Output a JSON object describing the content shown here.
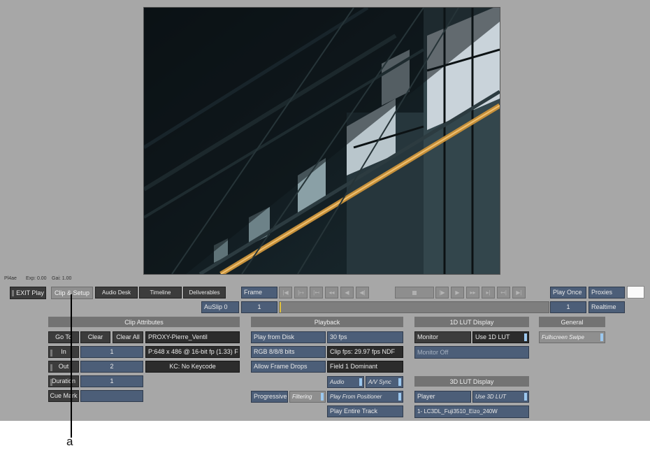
{
  "info": {
    "view": "Pl4ae",
    "exp": "Exp: 0.00",
    "gain": "Gai: 1.00"
  },
  "nav": {
    "exit": "EXIT Play",
    "clip_setup": "Clip & Setup",
    "audio_desk": "Audio Desk",
    "timeline": "Timeline",
    "deliverables": "Deliverables"
  },
  "transport": {
    "mode": "Frame",
    "buttons": [
      "|◀",
      "|↦",
      "|↤",
      "◂◂",
      "◀",
      "◀|",
      "|▶",
      "▶",
      "▸▸",
      "▸|",
      "↤|",
      "▶|"
    ],
    "play_once": "Play Once",
    "proxies": "Proxies",
    "auslip": "AuSlip 0",
    "frame_field": "1",
    "frame_end": "1",
    "realtime": "Realtime"
  },
  "clip": {
    "header": "Clip Attributes",
    "goto": "Go To",
    "clear": "Clear",
    "clear_all": "Clear All",
    "in": "In",
    "in_val": "1",
    "out": "Out",
    "out_val": "2",
    "duration": "Duration",
    "duration_val": "1",
    "cue_mark": "Cue Mark",
    "cue_val": "",
    "name": "PROXY-Pierre_Ventil",
    "format": "P:648 x 486 @ 16-bit fp (1.33) F",
    "keycode": "KC: No Keycode"
  },
  "playback": {
    "header": "Playback",
    "play_from": "Play from Disk",
    "fps": "30 fps",
    "rgb": "RGB 8/8/8 bits",
    "clip_fps": "Clip fps: 29.97 fps NDF",
    "frame_drops": "Allow Frame Drops",
    "field": "Field 1 Dominant",
    "audio": "Audio",
    "av_sync": "A/V Sync",
    "progressive": "Progressive",
    "filtering": "Filtering",
    "play_positioner": "Play From Positioner",
    "play_track": "Play Entire Track"
  },
  "lut1d": {
    "header": "1D LUT Display",
    "monitor": "Monitor",
    "use": "Use 1D LUT",
    "monitor_off": "Monitor Off"
  },
  "lut3d": {
    "header": "3D LUT Display",
    "player": "Player",
    "use": "Use 3D LUT",
    "lut_name": "1- LC3DL_Fuji3510_Eizo_240W"
  },
  "general": {
    "header": "General",
    "swipe": "Fullscreen Swipe"
  },
  "callout": {
    "label": "a"
  }
}
